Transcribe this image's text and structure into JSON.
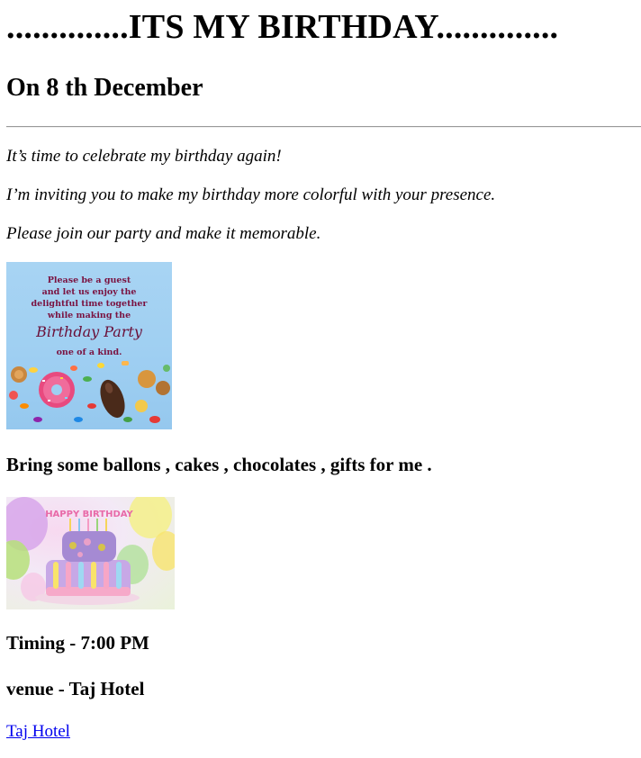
{
  "heading": "..............ITS MY BIRTHDAY..............",
  "date_heading": "On 8 th December",
  "paragraphs": [
    "It’s time to celebrate my birthday again!",
    "I’m inviting you to make my birthday more colorful with your presence.",
    "Please join our party and make it memorable."
  ],
  "invitation_image": {
    "lines": [
      "Please be a guest",
      "and let us enjoy the",
      "delightful time together",
      "while making the"
    ],
    "script_text": "Birthday Party",
    "closing": "one of a kind."
  },
  "bring_text": "Bring some ballons , cakes , chocolates , gifts for me .",
  "cake_image": {
    "topper_text": "HAPPY BIRTHDAY"
  },
  "timing": "Timing - 7:00 PM",
  "venue": "venue - Taj Hotel",
  "venue_link": "Taj Hotel"
}
